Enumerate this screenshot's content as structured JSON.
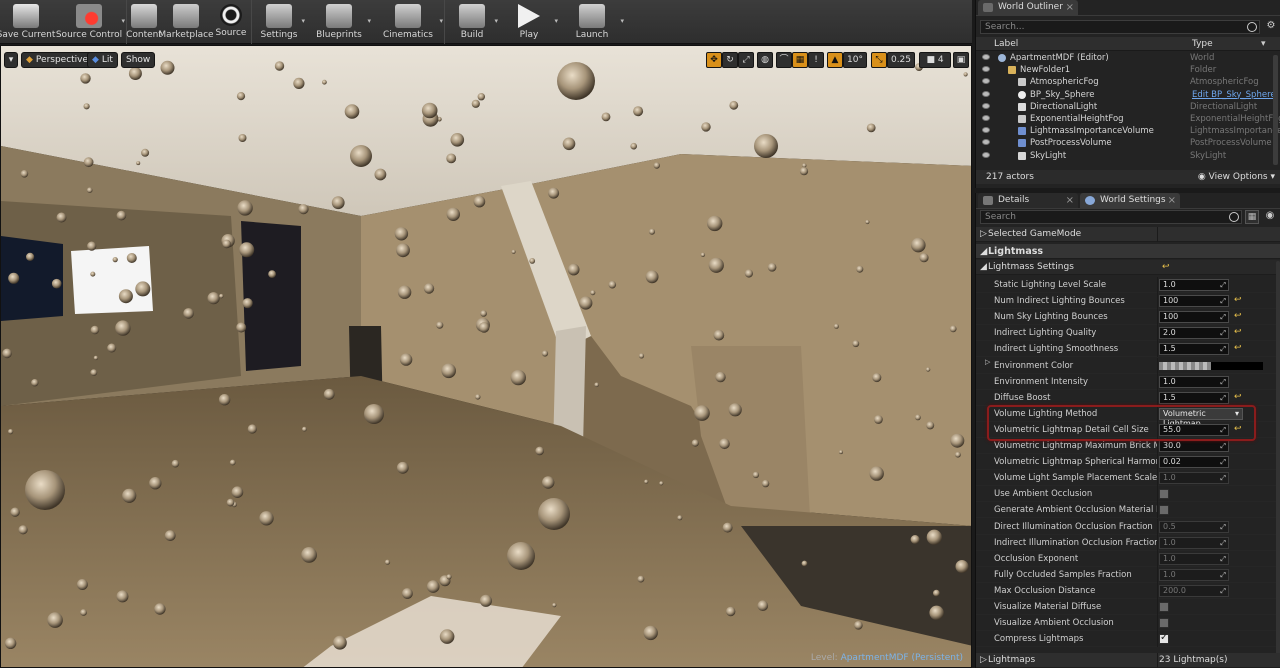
{
  "toolbar": {
    "buttons": [
      {
        "label": "Save Current",
        "icon": "save-icon",
        "color": "#e7e7e7"
      },
      {
        "label": "Source Control",
        "icon": "source-control-icon",
        "color": "#ff3b30"
      },
      {
        "label": "Content",
        "icon": "content-icon",
        "color": "#d8d8d8"
      },
      {
        "label": "Marketplace",
        "icon": "marketplace-icon",
        "color": "#cccccc"
      },
      {
        "label": "Source",
        "icon": "source-icon",
        "color": "#f0f0f0"
      },
      {
        "label": "Settings",
        "icon": "settings-icon",
        "color": "#d0d0d0"
      },
      {
        "label": "Blueprints",
        "icon": "blueprints-icon",
        "color": "#d0d0d0"
      },
      {
        "label": "Cinematics",
        "icon": "cinematics-icon",
        "color": "#d0d0d0"
      },
      {
        "label": "Build",
        "icon": "build-icon",
        "color": "#d0d0d0"
      },
      {
        "label": "Play",
        "icon": "play-icon",
        "color": "#f0f0f0"
      },
      {
        "label": "Launch",
        "icon": "launch-icon",
        "color": "#d0d0d0"
      }
    ]
  },
  "viewport": {
    "perspective_label": "Perspective",
    "lit_label": "Lit",
    "show_label": "Show",
    "grid_snap": "10°",
    "scale_snap": "0.25",
    "camera_speed": "4",
    "level_prefix": "Level:",
    "level_name": "ApartmentMDF (Persistent)"
  },
  "outliner": {
    "tab_label": "World Outliner",
    "search_placeholder": "Search...",
    "col_label": "Label",
    "col_type": "Type",
    "rows": [
      {
        "label": "ApartmentMDF (Editor)",
        "type": "World",
        "link": false,
        "indent": 0,
        "icon": "world-icon"
      },
      {
        "label": "NewFolder1",
        "type": "Folder",
        "link": false,
        "indent": 1,
        "icon": "folder-icon"
      },
      {
        "label": "AtmosphericFog",
        "type": "AtmosphericFog",
        "link": false,
        "indent": 2,
        "icon": "fog-icon"
      },
      {
        "label": "BP_Sky_Sphere",
        "type": "Edit BP_Sky_Sphere",
        "link": true,
        "indent": 2,
        "icon": "sphere-icon"
      },
      {
        "label": "DirectionalLight",
        "type": "DirectionalLight",
        "link": false,
        "indent": 2,
        "icon": "light-icon"
      },
      {
        "label": "ExponentialHeightFog",
        "type": "ExponentialHeightFog",
        "link": false,
        "indent": 2,
        "icon": "fog-icon"
      },
      {
        "label": "LightmassImportanceVolume",
        "type": "LightmassImportance",
        "link": false,
        "indent": 2,
        "icon": "volume-icon"
      },
      {
        "label": "PostProcessVolume",
        "type": "PostProcessVolume",
        "link": false,
        "indent": 2,
        "icon": "volume-icon"
      },
      {
        "label": "SkyLight",
        "type": "SkyLight",
        "link": false,
        "indent": 2,
        "icon": "skylight-icon"
      }
    ],
    "actor_count": "217 actors",
    "view_options": "View Options"
  },
  "details": {
    "tab_details": "Details",
    "tab_world_settings": "World Settings",
    "search_placeholder": "Search",
    "selected_gamemode": "Selected GameMode",
    "lightmass_category": "Lightmass",
    "lightmass_settings": "Lightmass Settings",
    "props": [
      {
        "label": "Static Lighting Level Scale",
        "kind": "num",
        "value": "1.0",
        "reset": false,
        "dim": false
      },
      {
        "label": "Num Indirect Lighting Bounces",
        "kind": "num",
        "value": "100",
        "reset": true,
        "dim": false
      },
      {
        "label": "Num Sky Lighting Bounces",
        "kind": "num",
        "value": "100",
        "reset": true,
        "dim": false
      },
      {
        "label": "Indirect Lighting Quality",
        "kind": "num",
        "value": "2.0",
        "reset": true,
        "dim": false
      },
      {
        "label": "Indirect Lighting Smoothness",
        "kind": "num",
        "value": "1.5",
        "reset": true,
        "dim": false
      },
      {
        "label": "Environment Color",
        "kind": "color",
        "value": "",
        "reset": false,
        "dim": false
      },
      {
        "label": "Environment Intensity",
        "kind": "num",
        "value": "1.0",
        "reset": false,
        "dim": false
      },
      {
        "label": "Diffuse Boost",
        "kind": "num",
        "value": "1.5",
        "reset": true,
        "dim": false
      },
      {
        "label": "Volume Lighting Method",
        "kind": "dropdown",
        "value": "Volumetric Lightmap",
        "reset": false,
        "dim": false
      },
      {
        "label": "Volumetric Lightmap Detail Cell Size",
        "kind": "num",
        "value": "55.0",
        "reset": true,
        "dim": false
      },
      {
        "label": "Volumetric Lightmap Maximum Brick Memory Mb",
        "kind": "num",
        "value": "30.0",
        "reset": false,
        "dim": false
      },
      {
        "label": "Volumetric Lightmap Spherical Harmonic Smoothing",
        "kind": "num",
        "value": "0.02",
        "reset": false,
        "dim": false
      },
      {
        "label": "Volume Light Sample Placement Scale",
        "kind": "num",
        "value": "1.0",
        "reset": false,
        "dim": true
      },
      {
        "label": "Use Ambient Occlusion",
        "kind": "check",
        "checked": false,
        "reset": false
      },
      {
        "label": "Generate Ambient Occlusion Material Mask",
        "kind": "check",
        "checked": false,
        "reset": false
      },
      {
        "label": "Direct Illumination Occlusion Fraction",
        "kind": "num",
        "value": "0.5",
        "reset": false,
        "dim": true
      },
      {
        "label": "Indirect Illumination Occlusion Fraction",
        "kind": "num",
        "value": "1.0",
        "reset": false,
        "dim": true
      },
      {
        "label": "Occlusion Exponent",
        "kind": "num",
        "value": "1.0",
        "reset": false,
        "dim": true
      },
      {
        "label": "Fully Occluded Samples Fraction",
        "kind": "num",
        "value": "1.0",
        "reset": false,
        "dim": true
      },
      {
        "label": "Max Occlusion Distance",
        "kind": "num",
        "value": "200.0",
        "reset": false,
        "dim": true
      },
      {
        "label": "Visualize Material Diffuse",
        "kind": "check",
        "checked": false,
        "reset": false
      },
      {
        "label": "Visualize Ambient Occlusion",
        "kind": "check",
        "checked": false,
        "reset": false
      },
      {
        "label": "Compress Lightmaps",
        "kind": "check",
        "checked": true,
        "reset": false
      }
    ],
    "lightmaps_label": "Lightmaps",
    "lightmaps_value": "23 Lightmap(s)"
  },
  "colors": {
    "accent_orange": "#d9901a",
    "highlight_red": "#8a1c1c",
    "link_blue": "#6ea6ec",
    "reset_yellow": "#e8c04b"
  }
}
